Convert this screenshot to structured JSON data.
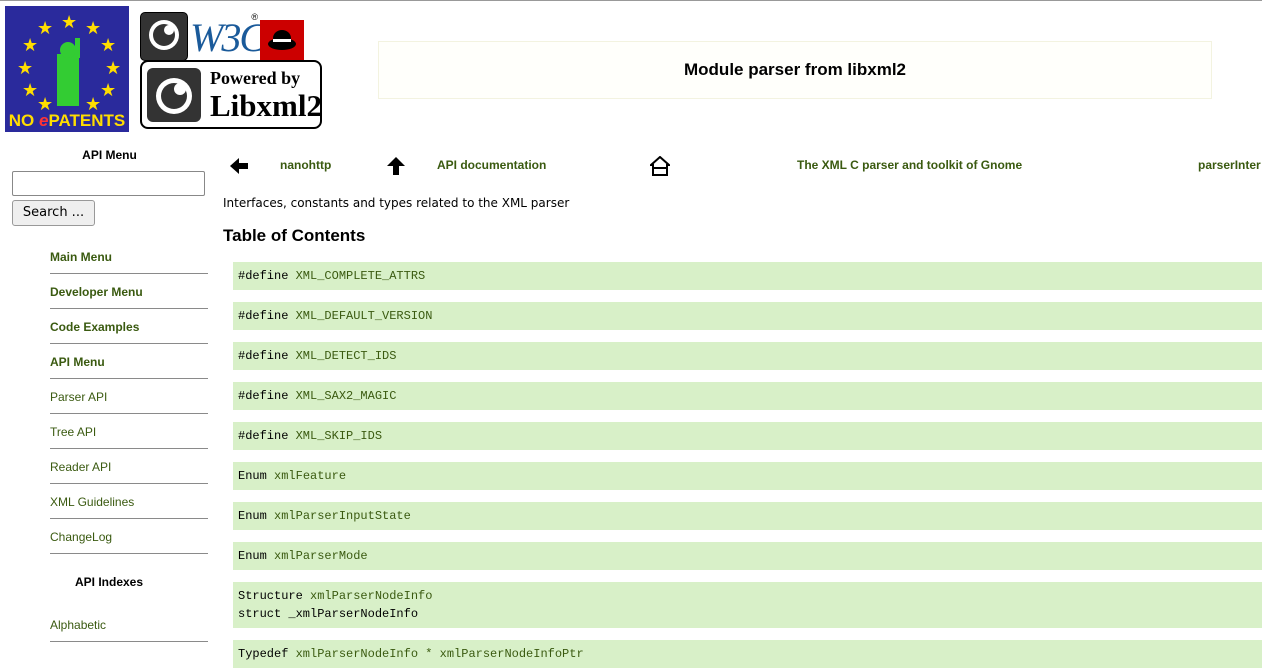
{
  "logos": {
    "nopatents": {
      "text_prefix": "NO ",
      "text_e": "e",
      "text_suffix": "PATENTS"
    },
    "w3c": {
      "text": "W3C",
      "reg": "®"
    },
    "libxml2": {
      "powered": "Powered by",
      "name": "Libxml2"
    }
  },
  "page_title": "Module parser from libxml2",
  "sidebar": {
    "menu_title": "API Menu",
    "search_value": "",
    "search_button": "Search ...",
    "items": [
      {
        "label": "Main Menu",
        "bold": true
      },
      {
        "label": "Developer Menu",
        "bold": true
      },
      {
        "label": "Code Examples",
        "bold": true
      },
      {
        "label": "API Menu",
        "bold": true
      },
      {
        "label": "Parser API",
        "bold": false
      },
      {
        "label": "Tree API",
        "bold": false
      },
      {
        "label": "Reader API",
        "bold": false
      },
      {
        "label": "XML Guidelines",
        "bold": false
      },
      {
        "label": "ChangeLog",
        "bold": false
      }
    ],
    "indexes_title": "API Indexes",
    "indexes_items": [
      {
        "label": "Alphabetic"
      }
    ]
  },
  "nav": {
    "prev_label": "nanohttp",
    "up_label": "API documentation",
    "home_label": "The XML C parser and toolkit of Gnome",
    "next_label": "parserInter"
  },
  "intro": "Interfaces, constants and types related to the XML parser",
  "toc_title": "Table of Contents",
  "toc": [
    {
      "lines": [
        {
          "kw": "#define ",
          "name": "XML_COMPLETE_ATTRS"
        }
      ]
    },
    {
      "lines": [
        {
          "kw": "#define ",
          "name": "XML_DEFAULT_VERSION"
        }
      ]
    },
    {
      "lines": [
        {
          "kw": "#define ",
          "name": "XML_DETECT_IDS"
        }
      ]
    },
    {
      "lines": [
        {
          "kw": "#define ",
          "name": "XML_SAX2_MAGIC"
        }
      ]
    },
    {
      "lines": [
        {
          "kw": "#define ",
          "name": "XML_SKIP_IDS"
        }
      ]
    },
    {
      "lines": [
        {
          "kw": "Enum ",
          "name": "xmlFeature"
        }
      ]
    },
    {
      "lines": [
        {
          "kw": "Enum ",
          "name": "xmlParserInputState"
        }
      ]
    },
    {
      "lines": [
        {
          "kw": "Enum ",
          "name": "xmlParserMode"
        }
      ]
    },
    {
      "lines": [
        {
          "kw": "Structure ",
          "name": "xmlParserNodeInfo"
        },
        {
          "kw": "struct _xmlParserNodeInfo",
          "name": ""
        }
      ]
    },
    {
      "lines": [
        {
          "kw": "Typedef ",
          "name": "xmlParserNodeInfo * xmlParserNodeInfoPtr"
        }
      ]
    }
  ]
}
